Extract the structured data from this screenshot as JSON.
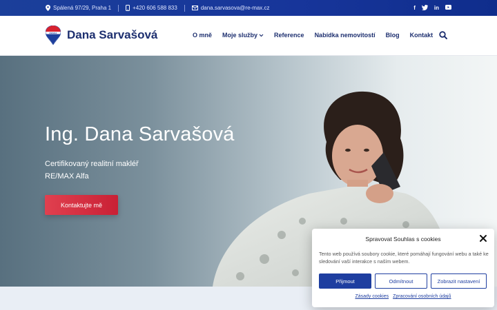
{
  "topbar": {
    "address": "Spálená 97/29, Praha 1",
    "phone": "+420 606 588 833",
    "email": "dana.sarvasova@re-max.cz",
    "social": [
      "f",
      "t",
      "in",
      "▶"
    ]
  },
  "header": {
    "brand": "Dana Sarvašová",
    "nav": [
      "O mně",
      "Moje služby",
      "Reference",
      "Nabídka nemovitostí",
      "Blog",
      "Kontakt"
    ]
  },
  "hero": {
    "title": "Ing. Dana Sarvašová",
    "subtitle_line1": "Certifikovaný realitní makléř",
    "subtitle_line2": "RE/MAX Alfa",
    "cta": "Kontaktujte mě"
  },
  "cookie": {
    "title": "Spravovat Souhlas s cookies",
    "text": "Tento web používá soubory cookie, které pomáhají fungování webu a také ke sledování vaší interakce s naším webem.",
    "accept": "Přijmout",
    "decline": "Odmítnout",
    "settings": "Zobrazit nastavení",
    "link_policy": "Zásady cookies",
    "link_privacy": "Zpracování osobních údajů"
  },
  "colors": {
    "brand_blue": "#1d2f6f",
    "topbar_blue": "#17359a",
    "cta_red": "#d0293b"
  }
}
